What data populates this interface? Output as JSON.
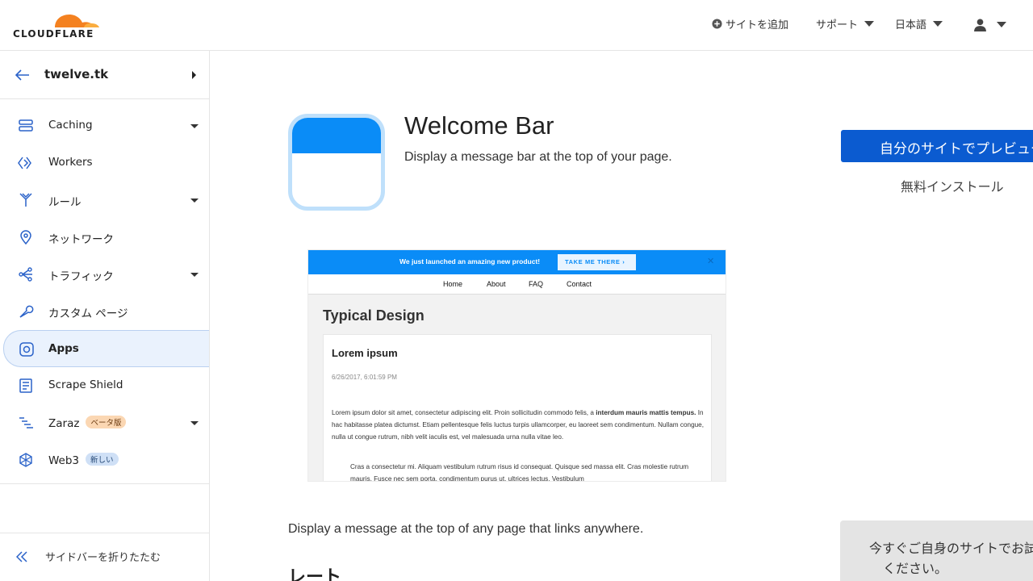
{
  "header": {
    "logo_text": "CLOUDFLARE",
    "add_site": "サイトを追加",
    "support": "サポート",
    "language": "日本語"
  },
  "sidebar": {
    "site_name": "twelve.tk",
    "items": [
      {
        "label": "Caching",
        "icon": "server-icon",
        "dropdown": true
      },
      {
        "label": "Workers",
        "icon": "workers-icon",
        "dropdown": false
      },
      {
        "label": "ルール",
        "icon": "rules-icon",
        "dropdown": true
      },
      {
        "label": "ネットワーク",
        "icon": "location-pin-icon",
        "dropdown": false
      },
      {
        "label": "トラフィック",
        "icon": "traffic-icon",
        "dropdown": true
      },
      {
        "label": "カスタム ページ",
        "icon": "wrench-icon",
        "dropdown": false
      },
      {
        "label": "Apps",
        "icon": "apps-icon",
        "dropdown": false,
        "active": true
      },
      {
        "label": "Scrape Shield",
        "icon": "document-icon",
        "dropdown": false
      },
      {
        "label": "Zaraz",
        "icon": "zaraz-icon",
        "dropdown": true,
        "badge": "ベータ版"
      },
      {
        "label": "Web3",
        "icon": "web3-icon",
        "dropdown": false,
        "badge": "新しい"
      }
    ],
    "collapse_label": "サイドバーを折りたたむ"
  },
  "app": {
    "title": "Welcome Bar",
    "subtitle": "Display a message bar at the top of your page.",
    "preview_button": "自分のサイトでプレビュー",
    "free_install": "無料インストール",
    "long_description": "Display a message at the top of any page that links anywhere.",
    "rate_heading": "レート",
    "try_text_line1": "今すぐご自身のサイトでお試し",
    "try_text_line2": "ください。"
  },
  "preview": {
    "message": "We just launched an amazing new product!",
    "cta": "TAKE ME THERE",
    "nav": [
      "Home",
      "About",
      "FAQ",
      "Contact"
    ],
    "heading": "Typical Design",
    "card_title": "Lorem ipsum",
    "card_date": "6/26/2017, 6:01:59 PM",
    "p1_a": "Lorem ipsum dolor sit amet, consectetur adipiscing elit. Proin sollicitudin commodo felis, a ",
    "p1_bold": "interdum mauris mattis tempus.",
    "p1_b": " In hac habitasse platea dictumst. Etiam pellentesque felis luctus turpis ullamcorper, eu laoreet sem condimentum. Nullam congue, nulla ut congue rutrum, nibh velit iaculis est, vel malesuada urna nulla vitae leo.",
    "p2": "Cras a consectetur mi. Aliquam vestibulum rutrum risus id consequat. Quisque sed massa elit. Cras molestie rutrum mauris. Fusce nec sem porta, condimentum purus ut, ultrices lectus. Vestibulum"
  },
  "colors": {
    "accent": "#0a8cf7",
    "primary_button": "#0b5bd0",
    "logo_orange": "#f48120",
    "logo_light_orange": "#faad3f"
  }
}
